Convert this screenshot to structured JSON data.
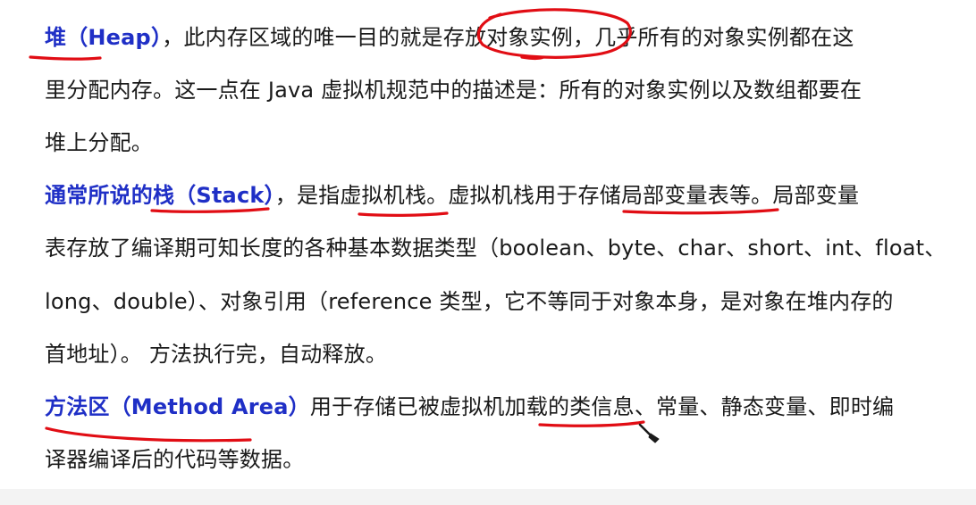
{
  "paragraphs": {
    "heap": {
      "term": "堆（Heap）",
      "line1_rest": "，此内存区域的唯一目的就是存放对象实例，几乎所有的对象实例都在这",
      "line2": "里分配内存。这一点在 Java 虚拟机规范中的描述是：所有的对象实例以及数组都要在",
      "line3": "堆上分配。"
    },
    "stack": {
      "term": "通常所说的栈（Stack）",
      "line1_rest": "，是指虚拟机栈。虚拟机栈用于存储局部变量表等。局部变量",
      "line2": "表存放了编译期可知长度的各种基本数据类型（boolean、byte、char、short、int、float、",
      "line3": "long、double）、对象引用（reference 类型，它不等同于对象本身，是对象在堆内存的",
      "line4": "首地址）。 方法执行完，自动释放。"
    },
    "method_area": {
      "term": "方法区（Method Area）",
      "line1_rest": "用于存储已被虚拟机加载的类信息、常量、静态变量、即时编",
      "line2": "译器编译后的代码等数据。"
    }
  },
  "colors": {
    "term": "#1f2fc6",
    "body_text": "#1a1a1a",
    "annotation": "#e10d14"
  },
  "icons": {
    "cursor": "pen-cursor-icon"
  }
}
